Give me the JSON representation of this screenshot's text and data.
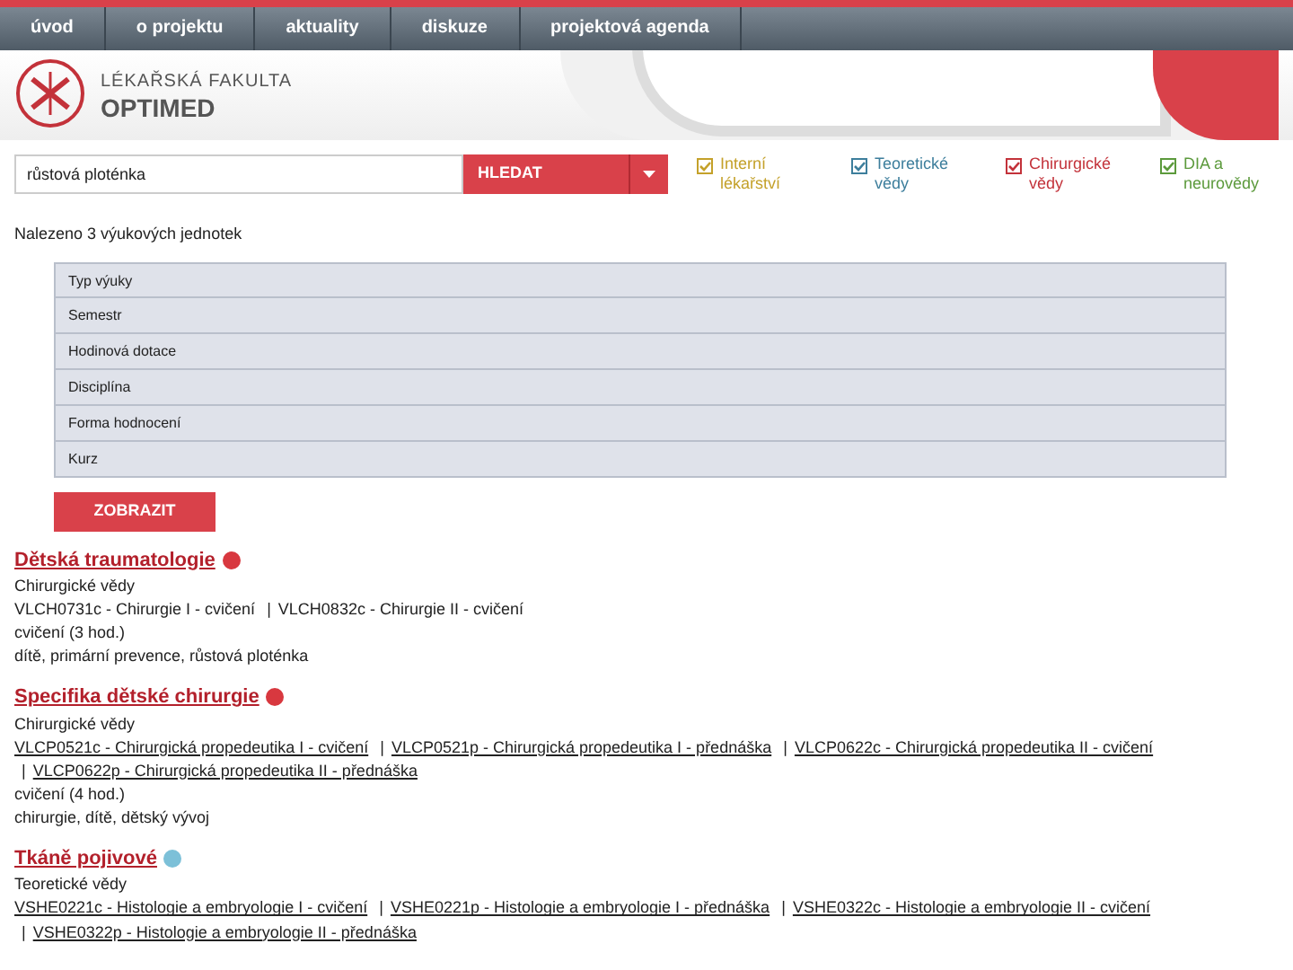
{
  "nav": [
    {
      "label": "úvod",
      "selected": false
    },
    {
      "label": "o projektu",
      "selected": false
    },
    {
      "label": "aktuality",
      "selected": false
    },
    {
      "label": "diskuze",
      "selected": false
    },
    {
      "label": "projektová agenda",
      "selected": false
    }
  ],
  "header": {
    "logo_line1": "LÉKAŘSKÁ FAKULTA",
    "logo_line2": "OPTIMED"
  },
  "search": {
    "value": "růstová ploténka",
    "button": "HLEDAT"
  },
  "categories": [
    {
      "label": "Interní lékařství",
      "checked": true,
      "color": "#c4a12a"
    },
    {
      "label": "Teoretické vědy",
      "checked": true,
      "color": "#3d7e9c"
    },
    {
      "label": "Chirurgické vědy",
      "checked": true,
      "color": "#c3323a"
    },
    {
      "label": "DIA a neurovědy",
      "checked": true,
      "color": "#5c9a3c"
    }
  ],
  "result_count": "Nalezeno 3 výukových jednotek",
  "filters": [
    "Typ výuky",
    "Semestr",
    "Hodinová dotace",
    "Disciplína",
    "Forma hodnocení",
    "Kurz"
  ],
  "show_button": "ZOBRAZIT",
  "results": [
    {
      "title": "Dětská traumatologie",
      "color": "#d8383f",
      "discipline": "Chirurgické vědy",
      "courses_linked": false,
      "separator": "|",
      "courses": [
        "VLCH0731c - Chirurgie I - cvičení",
        "VLCH0832c - Chirurgie II - cvičení"
      ],
      "type": "cvičení (3 hod.)",
      "keywords": "dítě, primární prevence, růstová ploténka"
    },
    {
      "title": "Specifika dětské chirurgie",
      "color": "#d8383f",
      "discipline": "Chirurgické vědy",
      "courses_linked": true,
      "separator": "|",
      "courses": [
        "VLCP0521c - Chirurgická propedeutika I - cvičení",
        "VLCP0521p - Chirurgická propedeutika I - přednáška",
        "VLCP0622c - Chirurgická propedeutika II - cvičení",
        "VLCP0622p - Chirurgická propedeutika II - přednáška"
      ],
      "type": "cvičení (4 hod.)",
      "keywords": "chirurgie, dítě, dětský vývoj"
    },
    {
      "title": "Tkáně pojivové",
      "color": "#7cc0d8",
      "discipline": "Teoretické vědy",
      "courses_linked": true,
      "separator": "|",
      "courses": [
        "VSHE0221c - Histologie a embryologie I - cvičení",
        "VSHE0221p - Histologie a embryologie I - přednáška",
        "VSHE0322c - Histologie a embryologie II - cvičení",
        "VSHE0322p - Histologie a embryologie II - přednáška"
      ]
    }
  ]
}
